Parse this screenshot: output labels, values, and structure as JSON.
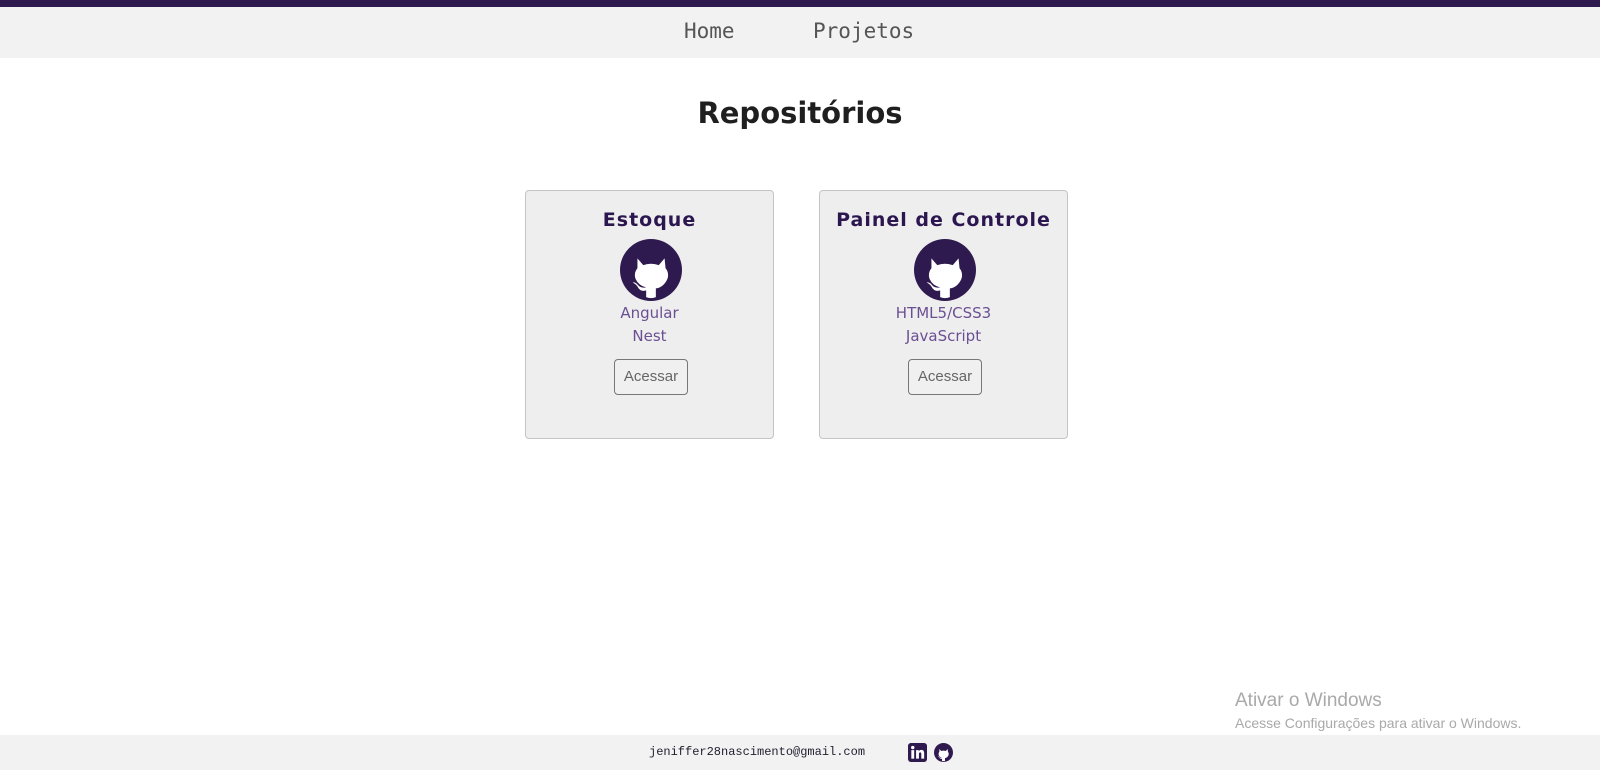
{
  "nav": {
    "items": [
      {
        "label": "Home"
      },
      {
        "label": "Projetos"
      }
    ]
  },
  "page": {
    "title": "Repositórios"
  },
  "cards": [
    {
      "title": "Estoque",
      "tech": [
        "Angular",
        "Nest"
      ],
      "button": "Acessar",
      "icon": "github-icon"
    },
    {
      "title": "Painel de Controle",
      "tech": [
        "HTML5/CSS3",
        "JavaScript"
      ],
      "button": "Acessar",
      "icon": "github-icon"
    }
  ],
  "footer": {
    "email": "jeniffer28nascimento@gmail.com",
    "icons": [
      "linkedin-icon",
      "github-icon"
    ]
  },
  "watermark": {
    "title": "Ativar o Windows",
    "subtitle": "Acesse Configurações para ativar o Windows."
  },
  "colors": {
    "accent": "#2f1a4f",
    "tech_text": "#6b4f93",
    "nav_bg": "#f2f2f2",
    "card_bg": "#eeeeee"
  }
}
